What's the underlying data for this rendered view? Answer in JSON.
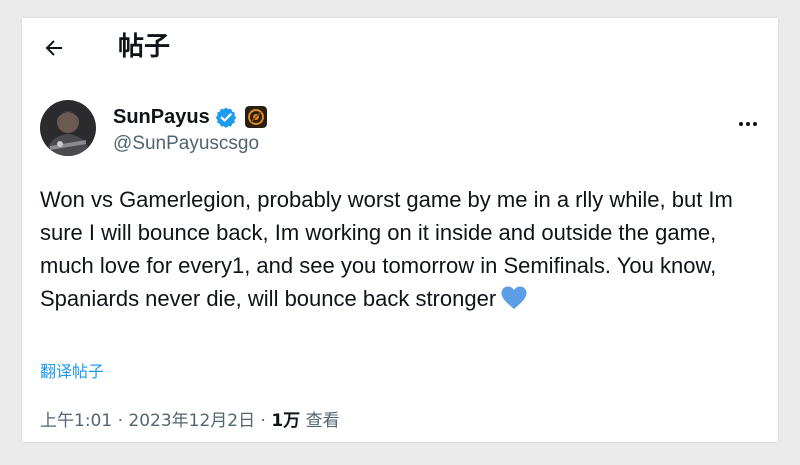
{
  "header": {
    "back_icon": "arrow-left-icon",
    "title": "帖子"
  },
  "author": {
    "display_name": "SunPayus",
    "handle": "@SunPayuscsgo",
    "verified_color": "#1d9bf0",
    "avatar": "avatar-icon",
    "affiliation_icon": "org-badge-icon"
  },
  "more_icon": "more-dots-icon",
  "tweet": {
    "text": "Won vs Gamerlegion, probably worst game by me in a rlly while, but Im sure I will bounce back, Im working on it inside and outside the game, much love for every1, and see you tomorrow in Semifinals. You know, Spaniards never die, will bounce back stronger",
    "emoji": "blue-heart-icon",
    "translate_label": "翻译帖子"
  },
  "meta": {
    "time": "上午1:01",
    "separator": " · ",
    "date": "2023年12月2日",
    "views_count": "1万",
    "views_label": " 查看"
  },
  "colors": {
    "accent": "#1d9bf0",
    "text": "#0f1419",
    "secondary": "#536471"
  }
}
